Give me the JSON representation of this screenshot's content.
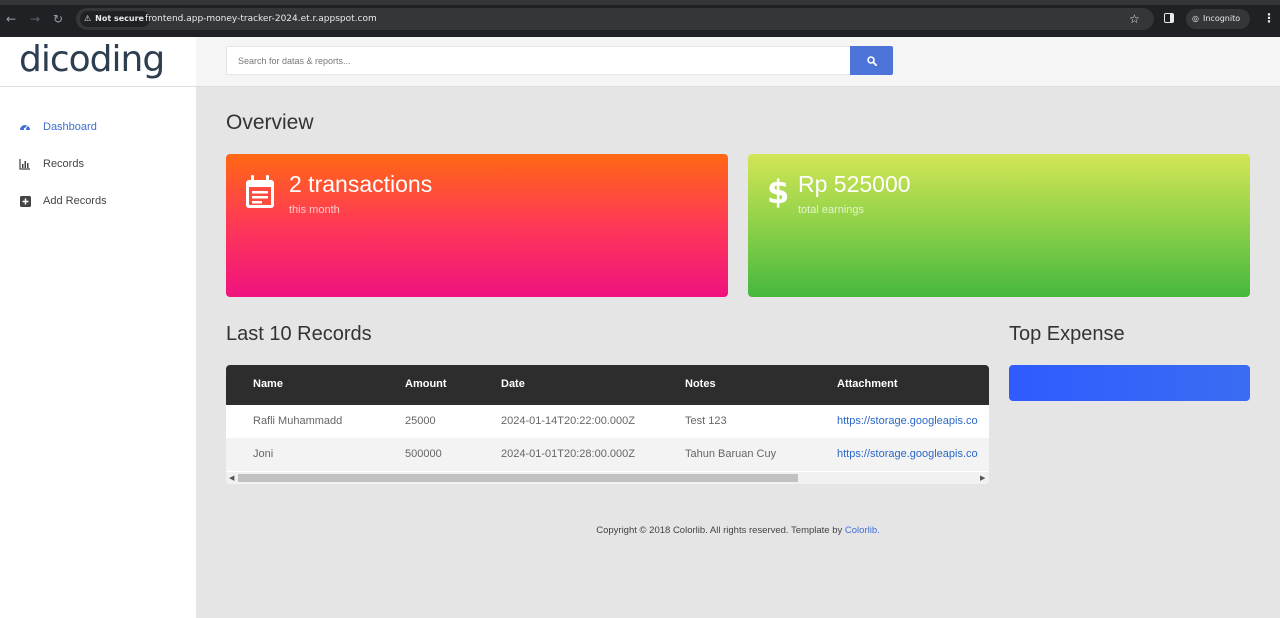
{
  "browser": {
    "security_label": "Not secure",
    "url": "frontend.app-money-tracker-2024.et.r.appspot.com",
    "incognito_label": "Incognito"
  },
  "brand": {
    "logo_text": "dicoding"
  },
  "search": {
    "placeholder": "Search for datas & reports..."
  },
  "sidebar": {
    "items": [
      {
        "label": "Dashboard",
        "icon": "dashboard-icon",
        "active": true
      },
      {
        "label": "Records",
        "icon": "bar-chart-icon",
        "active": false
      },
      {
        "label": "Add Records",
        "icon": "plus-square-icon",
        "active": false
      }
    ]
  },
  "overview": {
    "title": "Overview",
    "cards": [
      {
        "value": "2 transactions",
        "caption": "this month",
        "icon": "calendar-icon"
      },
      {
        "value": "Rp 525000",
        "caption": "total earnings",
        "icon": "dollar-icon"
      }
    ]
  },
  "records": {
    "title": "Last 10 Records",
    "columns": [
      "Name",
      "Amount",
      "Date",
      "Notes",
      "Attachment"
    ],
    "rows": [
      [
        "Rafli Muhammadd",
        "25000",
        "2024-01-14T20:22:00.000Z",
        "Test 123",
        "https://storage.googleapis.co"
      ],
      [
        "Joni",
        "500000",
        "2024-01-01T20:28:00.000Z",
        "Tahun Baruan Cuy",
        "https://storage.googleapis.co"
      ]
    ]
  },
  "top_expense": {
    "title": "Top Expense"
  },
  "footer": {
    "text": "Copyright © 2018 Colorlib. All rights reserved. Template by ",
    "link": "Colorlib."
  },
  "colors": {
    "accent": "#3f6ed4",
    "orange_card_top": "#ff6813",
    "orange_card_bottom": "#f0127f",
    "green_card_top": "#d3e556",
    "green_card_bottom": "#46b83e",
    "expense_bar": "#2f5bff"
  }
}
